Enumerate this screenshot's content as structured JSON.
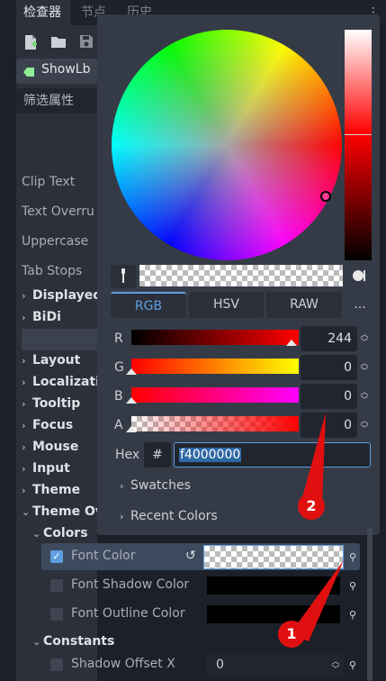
{
  "tabs": {
    "inspector": "检查器",
    "node": "节点",
    "history": "历史"
  },
  "inspector": {
    "node_name": "ShowLb",
    "filter_placeholder": "筛选属性",
    "props": [
      "Clip Text",
      "Text Overru",
      "Uppercase",
      "Tab Stops"
    ],
    "sections": [
      "Displayed",
      "BiDi",
      "Layout",
      "Localizatio",
      "Tooltip",
      "Focus",
      "Mouse",
      "Input",
      "Theme",
      "Theme Ov"
    ],
    "colors_sub": "Colors",
    "color_rows": [
      "Font Color",
      "Font Shadow Color",
      "Font Outline Color"
    ],
    "constants_sub": "Constants",
    "shadow_offset_label": "Shadow Offset X",
    "shadow_offset_value": "0"
  },
  "color_picker": {
    "modes": [
      "RGB",
      "HSV",
      "RAW"
    ],
    "more": "...",
    "channels": [
      {
        "label": "R",
        "value": "244",
        "fraction": 0.957
      },
      {
        "label": "G",
        "value": "0",
        "fraction": 0
      },
      {
        "label": "B",
        "value": "0",
        "fraction": 0
      },
      {
        "label": "A",
        "value": "0",
        "fraction": 0
      }
    ],
    "hex_label": "Hex",
    "hash": "#",
    "hex_value": "f4000000",
    "swatches": "Swatches",
    "recent": "Recent Colors"
  },
  "annotations": {
    "one": "1",
    "two": "2"
  },
  "colors": {
    "accent": "#5f9ee0",
    "annotation": "#e01010"
  }
}
